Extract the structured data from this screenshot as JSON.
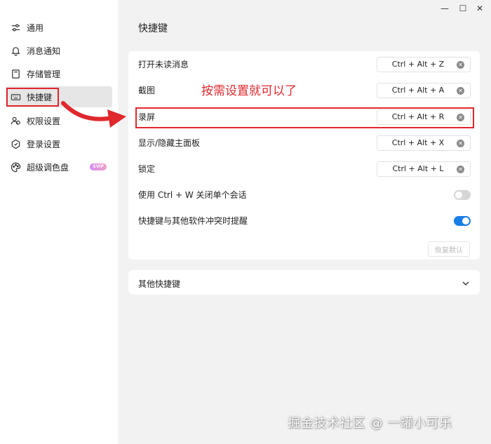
{
  "window": {
    "minimize_glyph": "—",
    "maximize_glyph": "☐",
    "close_glyph": "✕"
  },
  "sidebar": {
    "items": [
      {
        "label": "通用",
        "icon": "sliders-icon"
      },
      {
        "label": "消息通知",
        "icon": "bell-icon"
      },
      {
        "label": "存储管理",
        "icon": "storage-icon"
      },
      {
        "label": "快捷键",
        "icon": "keyboard-icon",
        "active": true
      },
      {
        "label": "权限设置",
        "icon": "users-icon"
      },
      {
        "label": "登录设置",
        "icon": "shield-icon"
      },
      {
        "label": "超级调色盘",
        "icon": "palette-icon",
        "badge": "SVIP"
      }
    ]
  },
  "page": {
    "title": "快捷键"
  },
  "shortcuts": {
    "rows": [
      {
        "label": "打开未读消息",
        "keys": "Ctrl + Alt + Z"
      },
      {
        "label": "截图",
        "keys": "Ctrl + Alt + A"
      },
      {
        "label": "录屏",
        "keys": "Ctrl + Alt + R"
      },
      {
        "label": "显示/隐藏主面板",
        "keys": "Ctrl + Alt + X"
      },
      {
        "label": "锁定",
        "keys": "Ctrl + Alt + L"
      }
    ],
    "toggles": [
      {
        "label": "使用 Ctrl + W 关闭单个会话",
        "on": false
      },
      {
        "label": "快捷键与其他软件冲突时提醒",
        "on": true
      }
    ],
    "restore_label": "恢复默认"
  },
  "other_shortcuts": {
    "label": "其他快捷键"
  },
  "annotation": {
    "text": "按需设置就可以了"
  },
  "watermark": {
    "text": "掘金技术社区 @ 一罐小可乐"
  },
  "colors": {
    "accent": "#1a7ee8",
    "highlight": "#e0282d",
    "badge": "#d58cf0",
    "background": "#f2f2f2"
  }
}
